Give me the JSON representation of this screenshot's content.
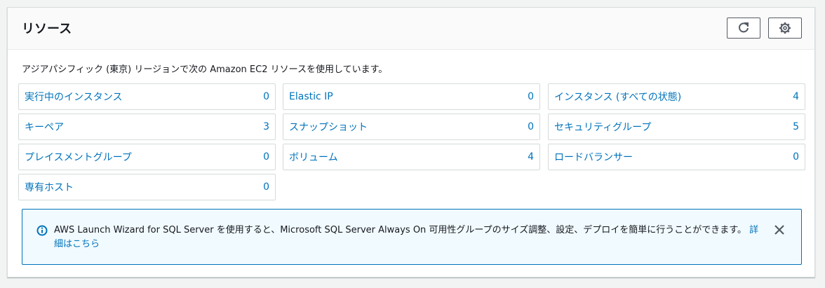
{
  "header": {
    "title": "リソース",
    "refresh_icon": "refresh-icon",
    "settings_icon": "gear-icon"
  },
  "description": "アジアパシフィック (東京) リージョンで次の Amazon EC2 リソースを使用しています。",
  "resources": [
    {
      "label": "実行中のインスタンス",
      "count": "0"
    },
    {
      "label": "Elastic IP",
      "count": "0"
    },
    {
      "label": "インスタンス (すべての状態)",
      "count": "4"
    },
    {
      "label": "キーペア",
      "count": "3"
    },
    {
      "label": "スナップショット",
      "count": "0"
    },
    {
      "label": "セキュリティグループ",
      "count": "5"
    },
    {
      "label": "プレイスメントグループ",
      "count": "0"
    },
    {
      "label": "ボリューム",
      "count": "4"
    },
    {
      "label": "ロードバランサー",
      "count": "0"
    },
    {
      "label": "専有ホスト",
      "count": "0"
    }
  ],
  "alert": {
    "icon": "info-icon",
    "message": "AWS Launch Wizard for SQL Server を使用すると、Microsoft SQL Server Always On 可用性グループのサイズ調整、設定、デプロイを簡単に行うことができます。",
    "link_text": "詳細はこちら",
    "close_icon": "close-icon"
  },
  "colors": {
    "link": "#0073bb",
    "alert_background": "#f1faff",
    "border": "#d5dbdb"
  }
}
